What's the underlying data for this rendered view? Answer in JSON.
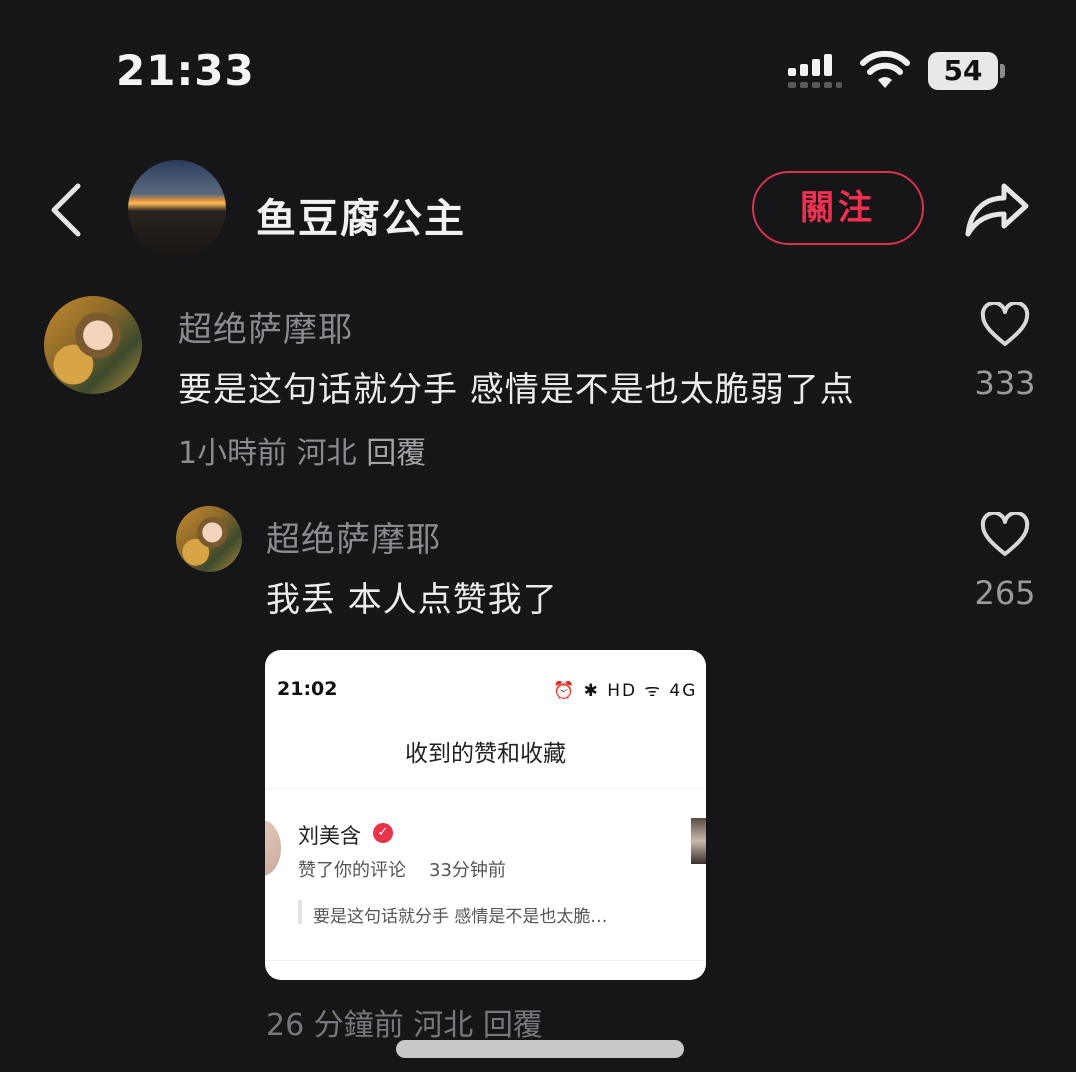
{
  "status_bar": {
    "time": "21:33",
    "battery": "54"
  },
  "header": {
    "title": "鱼豆腐公主",
    "follow_label": "關注"
  },
  "comments": [
    {
      "username": "超绝萨摩耶",
      "text": "要是这句话就分手 感情是不是也太脆弱了点",
      "time_ago": "1小時前",
      "location": "河北",
      "reply_label": "回覆",
      "likes": "333"
    },
    {
      "username": "超绝萨摩耶",
      "text": "我丢 本人点赞我了",
      "time_ago": "26 分鐘前",
      "location": "河北",
      "reply_label": "回覆",
      "likes": "265"
    }
  ],
  "embedded_screenshot": {
    "time": "21:02",
    "status_icons": "⏰ ✱ HD ᯤ 4G",
    "title": "收到的赞和收藏",
    "name": "刘美含",
    "action": "赞了你的评论",
    "ago": "33分钟前",
    "quote": "要是这句话就分手 感情是不是也太脆…"
  },
  "colors": {
    "background": "#161619",
    "accent": "#f0304f"
  }
}
